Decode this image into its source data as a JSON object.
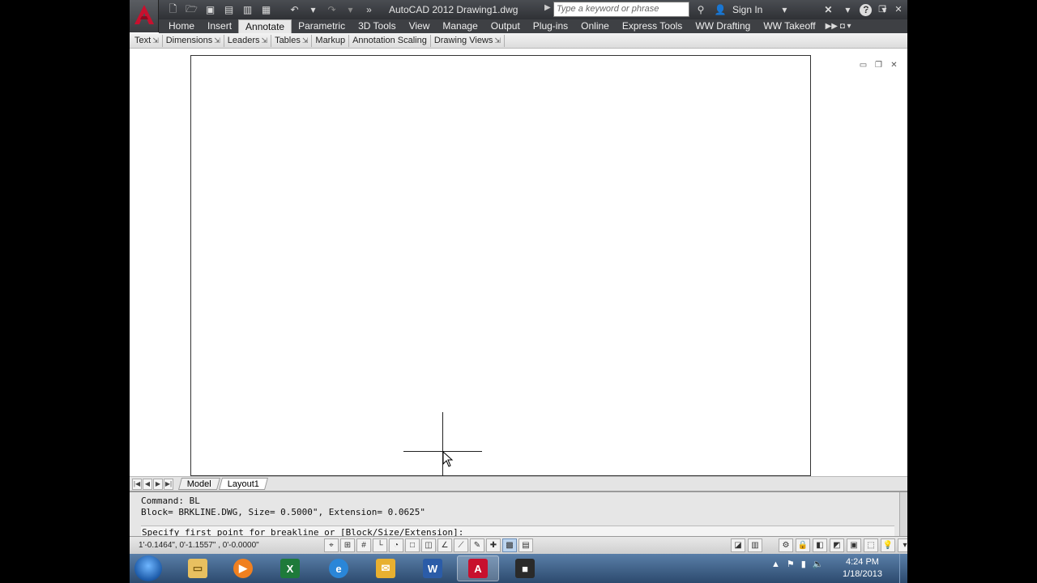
{
  "title_bar": {
    "app_title": "AutoCAD 2012    Drawing1.dwg",
    "search_placeholder": "Type a keyword or phrase",
    "sign_in": "Sign In",
    "icons": [
      "new-icon",
      "open-icon",
      "save-icon",
      "saveas-icon",
      "plot-icon",
      "print-icon",
      "undo-icon",
      "redo-icon"
    ]
  },
  "ribbon": {
    "tabs": [
      "Home",
      "Insert",
      "Annotate",
      "Parametric",
      "3D Tools",
      "View",
      "Manage",
      "Output",
      "Plug-ins",
      "Online",
      "Express Tools",
      "WW Drafting",
      "WW Takeoff"
    ],
    "active_tab": "Annotate",
    "panels": [
      "Text",
      "Dimensions",
      "Leaders",
      "Tables",
      "Markup",
      "Annotation Scaling",
      "Drawing Views"
    ]
  },
  "layout_tabs": [
    "Model",
    "Layout1"
  ],
  "active_layout": "Layout1",
  "command_line": {
    "history": [
      "Command: BL",
      "Block= BRKLINE.DWG, Size= 0.5000\", Extension= 0.0625\""
    ],
    "prompt": "Specify first point for breakline or [Block/Size/Extension]:"
  },
  "status_bar": {
    "coordinates": "1'-0.1464\", 0'-1.1557\" , 0'-0.0000\""
  },
  "taskbar": {
    "time": "4:24 PM",
    "date": "1/18/2013"
  },
  "colors": {
    "title_bg": "#3a3c40",
    "ribbon_active": "#e8e8e8",
    "taskbar": "#3b5f8a",
    "autocad_red": "#c8102e"
  }
}
